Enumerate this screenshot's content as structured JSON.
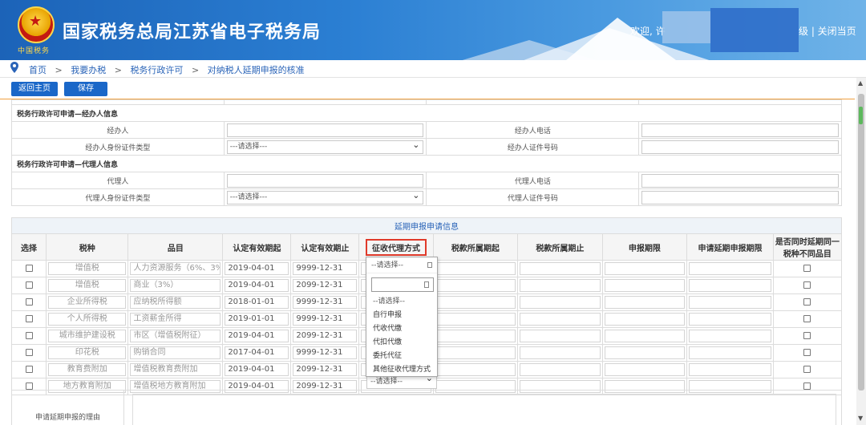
{
  "header": {
    "title": "国家税务总局江苏省电子税务局",
    "emblem_caption": "中国税务",
    "welcome": "欢迎, 许",
    "links_tail": "级 | 关闭当页"
  },
  "breadcrumb": {
    "items": [
      "首页",
      "我要办税",
      "税务行政许可",
      "对纳税人延期申报的核准"
    ],
    "sep": ">"
  },
  "toolbar": {
    "home_label": "返回主页",
    "save_label": "保存"
  },
  "agent_section": {
    "title": "税务行政许可申请—经办人信息",
    "name_label": "经办人",
    "phone_label": "经办人电话",
    "id_type_label": "经办人身份证件类型",
    "id_type_value": "---请选择---",
    "id_no_label": "经办人证件号码"
  },
  "proxy_section": {
    "title": "税务行政许可申请—代理人信息",
    "name_label": "代理人",
    "phone_label": "代理人电话",
    "id_type_label": "代理人身份证件类型",
    "id_type_value": "---请选择---",
    "id_no_label": "代理人证件号码"
  },
  "delay_table": {
    "title": "延期申报申请信息",
    "headers": [
      "选择",
      "税种",
      "品目",
      "认定有效期起",
      "认定有效期止",
      "征收代理方式",
      "税款所属期起",
      "税款所属期止",
      "申报期限",
      "申请延期申报期限",
      "是否同时延期同一税种不同品目"
    ],
    "rows": [
      {
        "tax": "增值税",
        "item": "人力资源服务（6%、3%",
        "from": "2019-04-01",
        "to": "9999-12-31"
      },
      {
        "tax": "增值税",
        "item": "商业（3%）",
        "from": "2019-04-01",
        "to": "2099-12-31"
      },
      {
        "tax": "企业所得税",
        "item": "应纳税所得额",
        "from": "2018-01-01",
        "to": "9999-12-31"
      },
      {
        "tax": "个人所得税",
        "item": "工资薪金所得",
        "from": "2019-01-01",
        "to": "9999-12-31"
      },
      {
        "tax": "城市维护建设税",
        "item": "市区（增值税附征）",
        "from": "2019-04-01",
        "to": "2099-12-31"
      },
      {
        "tax": "印花税",
        "item": "购销合同",
        "from": "2017-04-01",
        "to": "9999-12-31"
      },
      {
        "tax": "教育费附加",
        "item": "增值税教育费附加",
        "from": "2019-04-01",
        "to": "2099-12-31"
      },
      {
        "tax": "地方教育附加",
        "item": "增值税地方教育附加",
        "from": "2019-04-01",
        "to": "2099-12-31"
      }
    ]
  },
  "dropdown": {
    "header": "--请选择--",
    "options": [
      "--请选择--",
      "自行申报",
      "代收代缴",
      "代扣代缴",
      "委托代征",
      "其他征收代理方式"
    ],
    "under_value": "--请选择--"
  },
  "reason_label": "申请延期申报的理由",
  "colors": {
    "banner": "#2b7fd3",
    "button": "#1a67c8",
    "highlight": "#e03a2a",
    "link": "#2a64b8"
  }
}
